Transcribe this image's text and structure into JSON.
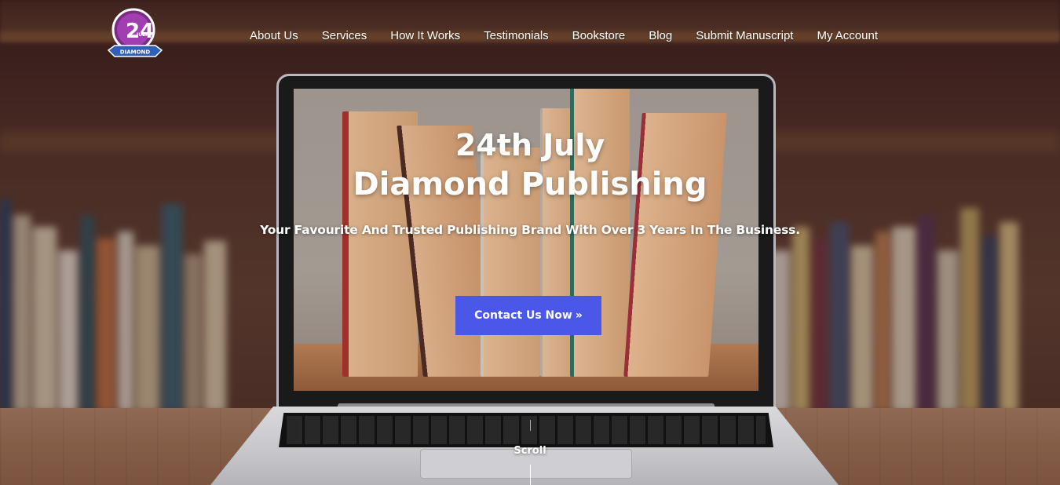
{
  "brand": {
    "logo_text": "24",
    "logo_small": "JULY",
    "logo_ribbon": "DIAMOND"
  },
  "nav": {
    "items": [
      {
        "label": "About Us"
      },
      {
        "label": "Services"
      },
      {
        "label": "How It Works"
      },
      {
        "label": "Testimonials"
      },
      {
        "label": "Bookstore"
      },
      {
        "label": "Blog"
      },
      {
        "label": "Submit Manuscript"
      },
      {
        "label": "My Account"
      }
    ]
  },
  "hero": {
    "title_line1": "24th July",
    "title_line2": "Diamond Publishing",
    "subtitle": "Your Favourite And Trusted Publishing Brand With Over 3 Years In The Business.",
    "cta_label": "Contact Us Now",
    "cta_icon": "»",
    "scroll_label": "Scroll"
  },
  "colors": {
    "accent": "#4b57e9",
    "logo_purple": "#7b2a86",
    "logo_blue": "#2f5fb8"
  }
}
